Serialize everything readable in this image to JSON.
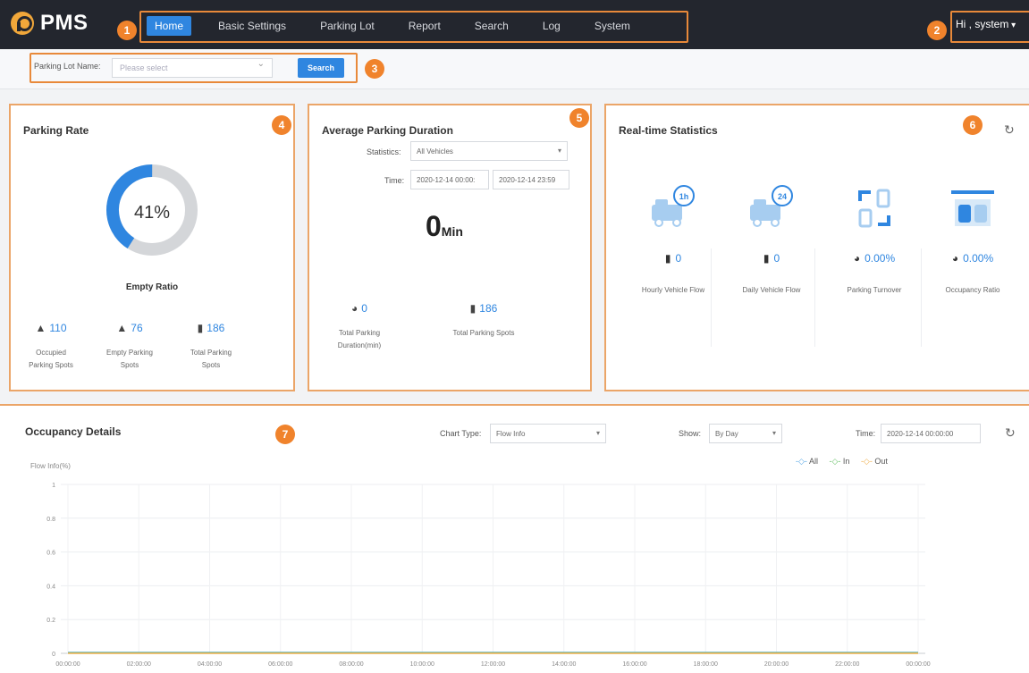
{
  "brand": {
    "name": "PMS"
  },
  "nav": {
    "items": [
      {
        "label": "Home",
        "active": true
      },
      {
        "label": "Basic Settings"
      },
      {
        "label": "Parking Lot"
      },
      {
        "label": "Report"
      },
      {
        "label": "Search"
      },
      {
        "label": "Log"
      },
      {
        "label": "System"
      }
    ],
    "user_label": "Hi , system"
  },
  "markers": [
    "1",
    "2",
    "3",
    "4",
    "5",
    "6",
    "7"
  ],
  "filter": {
    "label": "Parking Lot Name:",
    "placeholder": "Please select",
    "search_label": "Search"
  },
  "parking_rate": {
    "title": "Parking Rate",
    "percent_text": "41%",
    "percent": 41,
    "ratio_label": "Empty Ratio",
    "stats": [
      {
        "icon": "car-occupied-icon",
        "value": "110",
        "label_line1": "Occupied",
        "label_line2": "Parking Spots"
      },
      {
        "icon": "car-empty-icon",
        "value": "76",
        "label_line1": "Empty Parking",
        "label_line2": "Spots"
      },
      {
        "icon": "parking-spot-icon",
        "value": "186",
        "label_line1": "Total Parking",
        "label_line2": "Spots"
      }
    ]
  },
  "avg_duration": {
    "title": "Average Parking Duration",
    "statistics_label": "Statistics:",
    "statistics_value": "All Vehicles",
    "time_label": "Time:",
    "time_start": "2020-12-14 00:00:",
    "time_end": "2020-12-14 23:59",
    "value": "0",
    "unit": "Min",
    "stats": [
      {
        "icon": "clock-icon",
        "value": "0",
        "label_line1": "Total Parking",
        "label_line2": "Duration(min)"
      },
      {
        "icon": "parking-spot-icon",
        "value": "186",
        "label_line1": "Total Parking Spots",
        "label_line2": ""
      }
    ]
  },
  "realtime": {
    "title": "Real-time Statistics",
    "items": [
      {
        "icon": "hourly-flow-icon",
        "badge": "1h",
        "value": "0",
        "label": "Hourly Vehicle Flow"
      },
      {
        "icon": "daily-flow-icon",
        "badge": "24",
        "value": "0",
        "label": "Daily Vehicle Flow"
      },
      {
        "icon": "turnover-icon",
        "badge": "",
        "value": "0.00%",
        "label": "Parking Turnover"
      },
      {
        "icon": "occupancy-icon",
        "badge": "",
        "value": "0.00%",
        "label": "Occupancy Ratio"
      }
    ]
  },
  "occupancy": {
    "title": "Occupancy Details",
    "chart_type_label": "Chart Type:",
    "chart_type_value": "Flow Info",
    "show_label": "Show:",
    "show_value": "By Day",
    "time_label": "Time:",
    "time_value": "2020-12-14 00:00:00"
  },
  "colors": {
    "accent": "#2f86e0",
    "highlight": "#f0832c",
    "all": "#5aa9e6",
    "in": "#6cc26c",
    "out": "#f0b050"
  },
  "chart_data": {
    "type": "line",
    "ylabel": "Flow Info(%)",
    "ylim": [
      0,
      1
    ],
    "y_ticks": [
      "0",
      "0.2",
      "0.4",
      "0.6",
      "0.8",
      "1"
    ],
    "x": [
      "00:00:00",
      "02:00:00",
      "04:00:00",
      "06:00:00",
      "08:00:00",
      "10:00:00",
      "12:00:00",
      "14:00:00",
      "16:00:00",
      "18:00:00",
      "20:00:00",
      "22:00:00",
      "00:00:00"
    ],
    "legend_position": "top-right",
    "series": [
      {
        "name": "All",
        "values": [
          0,
          0,
          0,
          0,
          0,
          0,
          0,
          0,
          0,
          0,
          0,
          0,
          0
        ]
      },
      {
        "name": "In",
        "values": [
          0,
          0,
          0,
          0,
          0,
          0,
          0,
          0,
          0,
          0,
          0,
          0,
          0
        ]
      },
      {
        "name": "Out",
        "values": [
          0,
          0,
          0,
          0,
          0,
          0,
          0,
          0,
          0,
          0,
          0,
          0,
          0
        ]
      }
    ]
  }
}
